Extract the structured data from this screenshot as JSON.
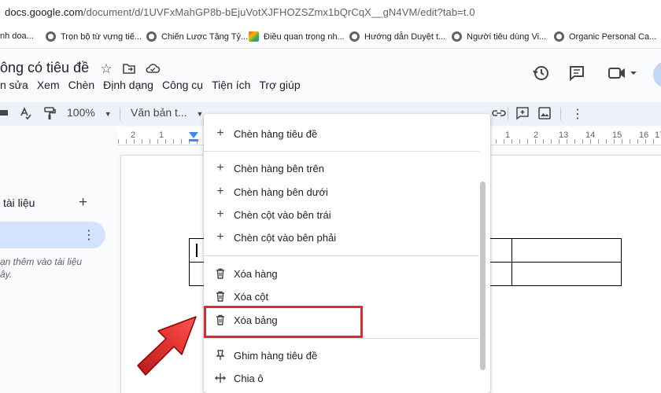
{
  "browser": {
    "url_host": "docs.google.com",
    "url_path": "/document/d/1UVFxMahGP8b-bEjuVotXJFHOZSZmx1bQrCqX__gN4VM/edit?tab=t.0"
  },
  "bookmarks": [
    {
      "label": "nh doa..."
    },
    {
      "label": "Trọn bộ từ vựng tiế..."
    },
    {
      "label": "Chiến Lược Tăng Tỷ..."
    },
    {
      "label": "Điều quan trọng nh..."
    },
    {
      "label": "Hướng dẫn Duyệt t..."
    },
    {
      "label": "Người tiêu dùng Vi..."
    },
    {
      "label": "Organic Personal Ca..."
    }
  ],
  "doc": {
    "title": "ông có tiêu đề",
    "menu": [
      "n sửa",
      "Xem",
      "Chèn",
      "Định dạng",
      "Công cụ",
      "Tiện ích",
      "Trợ giúp"
    ]
  },
  "toolbar": {
    "zoom": "100%",
    "style": "Văn bản t..."
  },
  "ruler": {
    "numbers": [
      "2",
      "1",
      "1",
      "2",
      "13",
      "14",
      "15",
      "16",
      "17"
    ]
  },
  "sidebar": {
    "title": "tài liệu",
    "add": "+",
    "note_line1": "ạn thêm vào tài liệu",
    "note_line2": "ây."
  },
  "context_menu": {
    "items": [
      {
        "label": "Chèn hàng tiêu đề",
        "icon": "plus-icon"
      },
      {
        "label": "Chèn hàng bên trên",
        "icon": "plus-icon"
      },
      {
        "label": "Chèn hàng bên dưới",
        "icon": "plus-icon"
      },
      {
        "label": "Chèn cột vào bên trái",
        "icon": "plus-icon"
      },
      {
        "label": "Chèn cột vào bên phải",
        "icon": "plus-icon"
      },
      {
        "label": "Xóa hàng",
        "icon": "trash-icon"
      },
      {
        "label": "Xóa cột",
        "icon": "trash-icon"
      },
      {
        "label": "Xóa bảng",
        "icon": "trash-icon"
      },
      {
        "label": "Ghim hàng tiêu đề",
        "icon": "pin-icon"
      },
      {
        "label": "Chia ô",
        "icon": "split-cell-icon"
      }
    ]
  },
  "annotation": {
    "highlight_color": "#d32f2f",
    "arrow_color": "#d32f2f"
  }
}
